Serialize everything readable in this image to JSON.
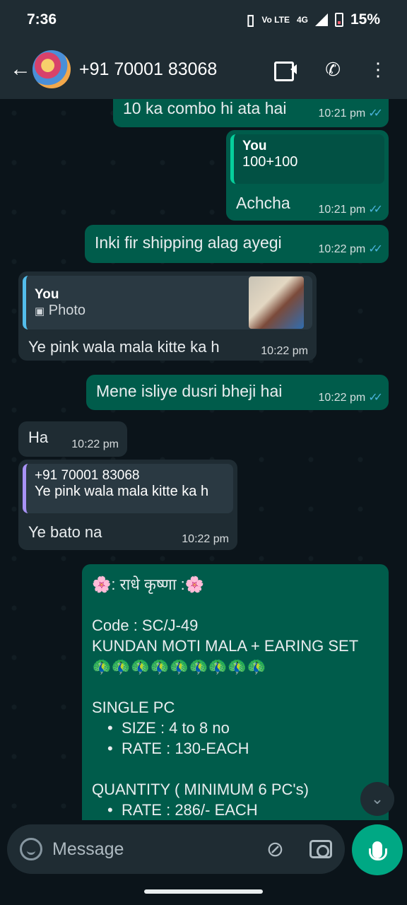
{
  "status_bar": {
    "time": "7:36",
    "network": "4G",
    "volte": "Vo LTE",
    "battery": "15%"
  },
  "header": {
    "contact": "+91 70001 83068",
    "back_icon": "arrow-left-icon",
    "video_icon": "video-camera-icon",
    "call_icon": "phone-icon",
    "menu_icon": "more-vertical-icon"
  },
  "messages": [
    {
      "dir": "out",
      "text": "10 ka combo hi ata hai",
      "time": "10:21 pm"
    },
    {
      "dir": "out",
      "quote_author": "You",
      "quote_text": "100+100",
      "text": "Achcha",
      "time": "10:21 pm"
    },
    {
      "dir": "out",
      "text": "Inki fir shipping alag ayegi",
      "time": "10:22 pm"
    },
    {
      "dir": "in",
      "quote_author": "You",
      "quote_text": "Photo",
      "text": "Ye pink wala mala kitte ka h",
      "time": "10:22 pm"
    },
    {
      "dir": "out",
      "text": "Mene isliye dusri bheji hai",
      "time": "10:22 pm"
    },
    {
      "dir": "in",
      "text": "Ha",
      "time": "10:22 pm"
    },
    {
      "dir": "in",
      "quote_author": "+91 70001 83068",
      "quote_text": "Ye pink wala mala kitte ka h",
      "text": "Ye bato na",
      "time": "10:22 pm"
    }
  ],
  "product_message": {
    "greeting": "🌸: राधे कृष्णा :🌸",
    "code": "Code : SC/J-49",
    "name": "KUNDAN MOTI MALA + EARING SET",
    "peacocks": "🦚🦚🦚🦚🦚🦚🦚🦚🦚",
    "single_title": "SINGLE PC",
    "single_items": [
      "SIZE :  4 to 8 no",
      "RATE : 130-EACH"
    ],
    "quantity_title": "QUANTITY ( MINIMUM 6 PC's)",
    "quantity_items": [
      "RATE : 286/- EACH"
    ]
  },
  "composer": {
    "placeholder": "Message"
  },
  "colors": {
    "outgoing": "#005c4b",
    "incoming": "#1f2c33",
    "accent": "#00a884",
    "ticks": "#53bdeb"
  }
}
